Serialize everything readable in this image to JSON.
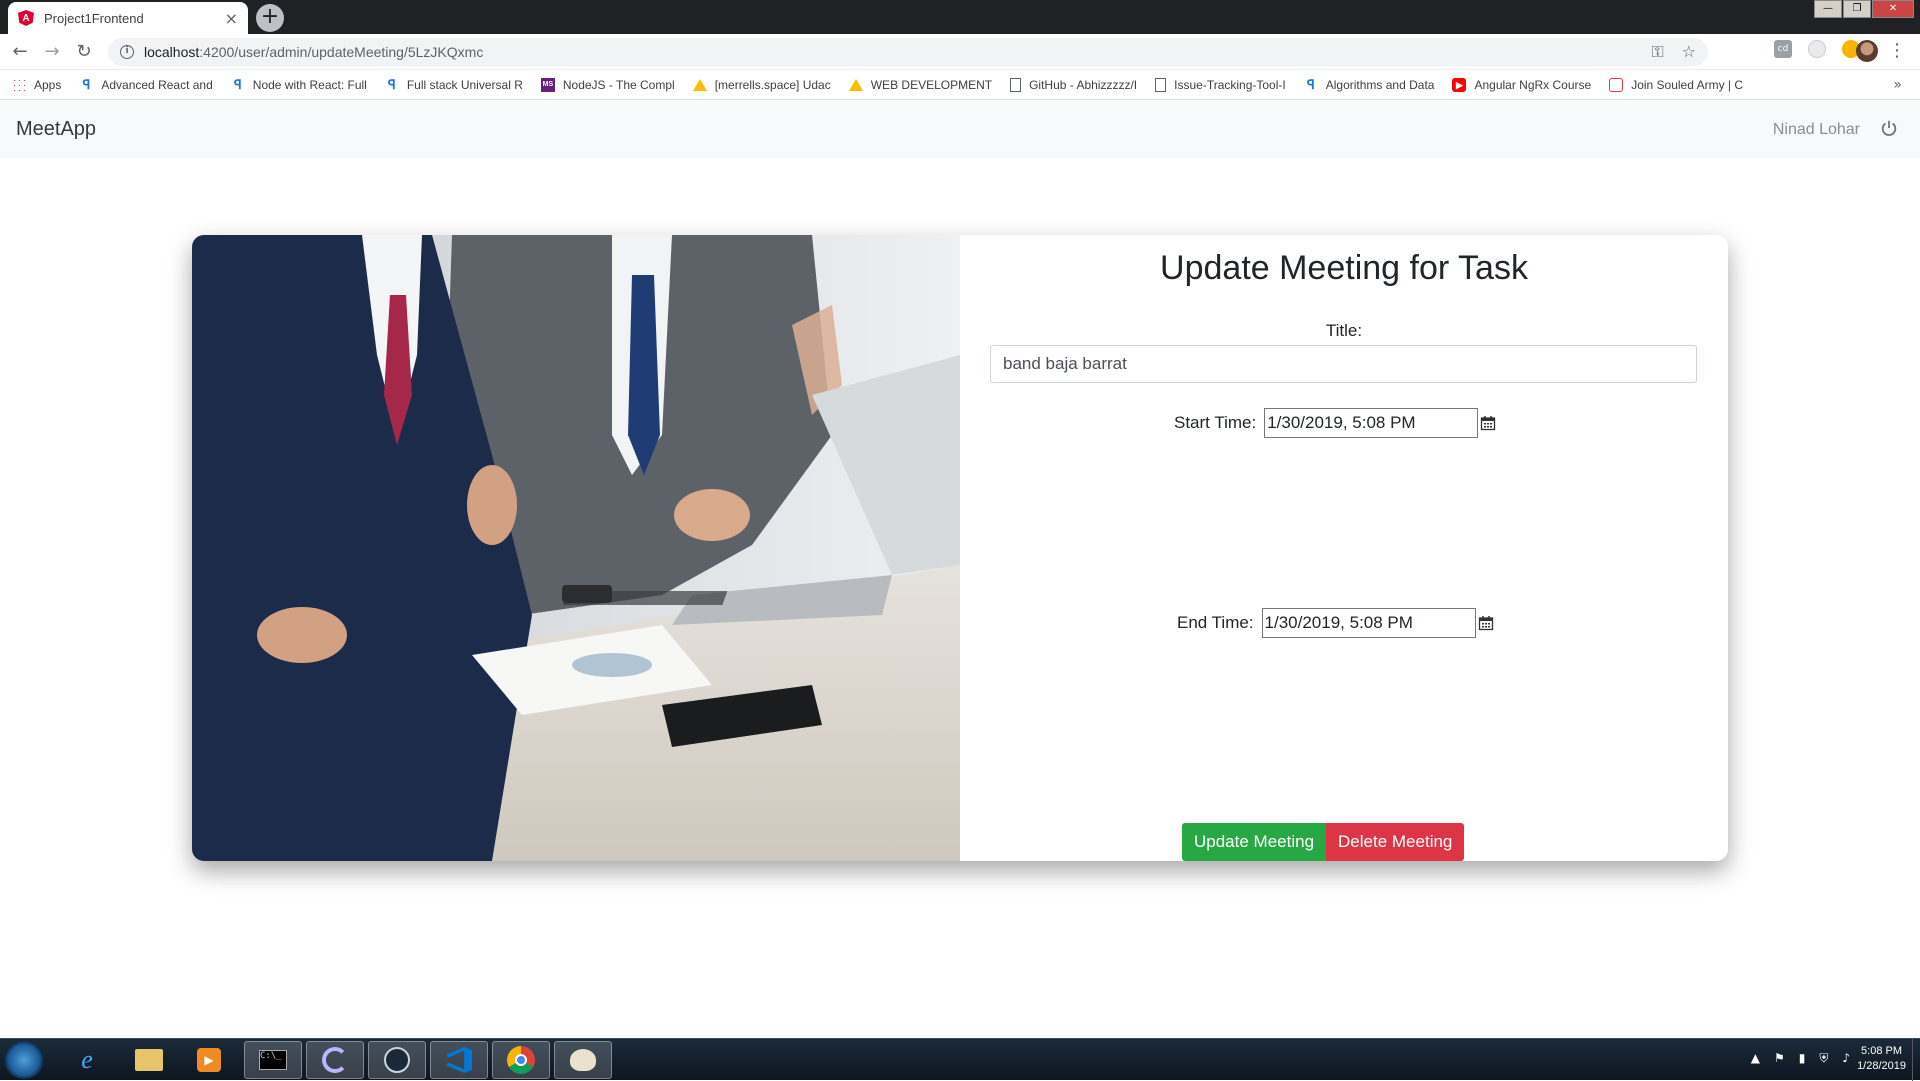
{
  "browser": {
    "tab_title": "Project1Frontend",
    "tab_close": "×",
    "new_tab": "+",
    "url_host": "localhost",
    "url_path": ":4200/user/admin/updateMeeting/5LzJKQxmc",
    "window_controls": [
      "—",
      "❐",
      "✕"
    ]
  },
  "bookmarks": [
    {
      "label": "Apps",
      "icon": "apps-grid-icon"
    },
    {
      "label": "Advanced React and",
      "icon": "sp-icon"
    },
    {
      "label": "Node with React: Full",
      "icon": "sp-icon"
    },
    {
      "label": "Full stack Universal R",
      "icon": "sp-icon"
    },
    {
      "label": "NodeJS - The Compl",
      "icon": "ms-icon"
    },
    {
      "label": "[merrells.space] Udac",
      "icon": "drive-icon"
    },
    {
      "label": "WEB DEVELOPMENT",
      "icon": "drive-icon"
    },
    {
      "label": "GitHub - Abhizzzzz/I",
      "icon": "doc-icon"
    },
    {
      "label": "Issue-Tracking-Tool-I",
      "icon": "doc-icon"
    },
    {
      "label": "Algorithms and Data",
      "icon": "sp-icon"
    },
    {
      "label": "Angular NgRx Course",
      "icon": "youtube-icon"
    },
    {
      "label": "Join Souled Army | C",
      "icon": "souled-icon"
    }
  ],
  "bookmarks_more": "»",
  "app": {
    "brand": "MeetApp",
    "user_name": "Ninad Lohar"
  },
  "form": {
    "heading": "Update Meeting for Task",
    "title_label": "Title:",
    "title_value": "band baja barrat",
    "start_label": "Start Time:",
    "start_value": "1/30/2019, 5:08 PM",
    "end_label": "End Time:",
    "end_value": "1/30/2019, 5:08 PM",
    "update_button": "Update Meeting",
    "delete_button": "Delete Meeting"
  },
  "colors": {
    "update": "#28a745",
    "delete": "#dc3545",
    "navbar_bg": "#f8f9fa"
  },
  "taskbar": {
    "time": "5:08 PM",
    "date": "1/28/2019",
    "items": [
      "start-orb",
      "internet-explorer",
      "file-explorer",
      "media-player",
      "command-prompt",
      "app-c",
      "steam",
      "vscode",
      "chrome",
      "paint"
    ]
  }
}
